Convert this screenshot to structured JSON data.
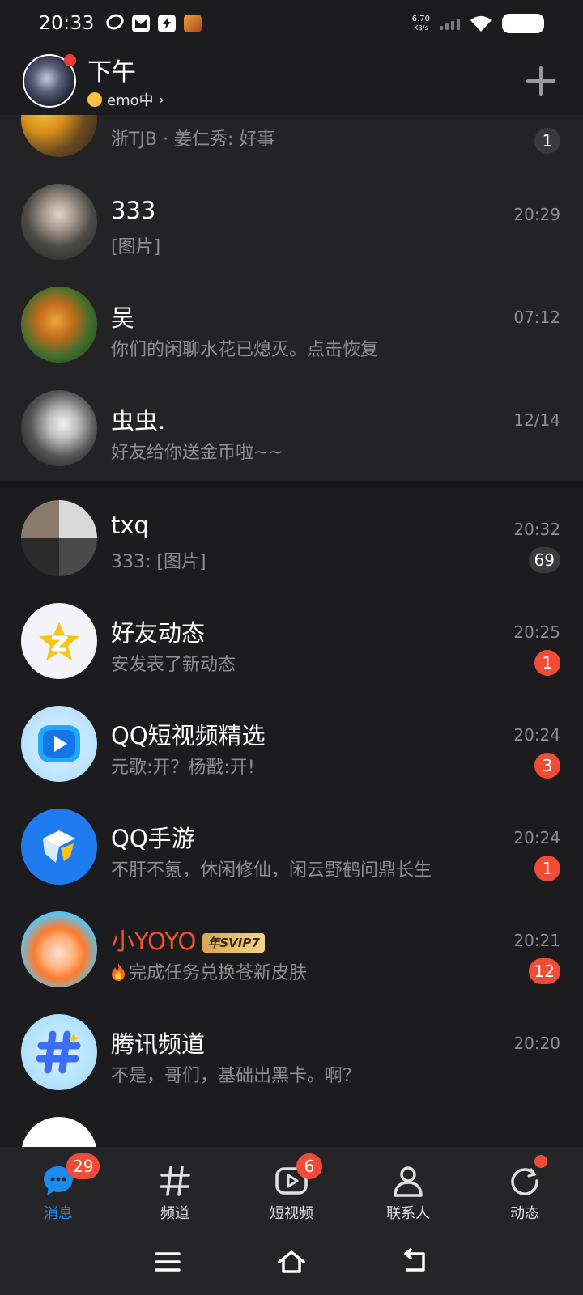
{
  "status_bar": {
    "time": "20:33",
    "net_speed_value": "6.70",
    "net_speed_unit": "KB/s"
  },
  "header": {
    "title": "下午",
    "status": "emo中"
  },
  "chats": [
    {
      "title": "",
      "subtitle": "浙TJB · 姜仁秀: 好事",
      "time": "",
      "badge": "1",
      "badge_style": "grey"
    },
    {
      "title": "333",
      "subtitle": "[图片]",
      "time": "20:29",
      "badge": "",
      "badge_style": ""
    },
    {
      "title": "吴",
      "subtitle": "你们的闲聊水花已熄灭。点击恢复",
      "time": "07:12",
      "badge": "",
      "badge_style": ""
    },
    {
      "title": "虫虫.",
      "subtitle": "好友给你送金币啦~~",
      "time": "12/14",
      "badge": "",
      "badge_style": ""
    },
    {
      "title": "txq",
      "subtitle": "333: [图片]",
      "time": "20:32",
      "badge": "69",
      "badge_style": "grey"
    },
    {
      "title": "好友动态",
      "subtitle": "安发表了新动态",
      "time": "20:25",
      "badge": "1",
      "badge_style": "red"
    },
    {
      "title": "QQ短视频精选",
      "subtitle": "元歌:开？杨戬:开!",
      "time": "20:24",
      "badge": "3",
      "badge_style": "red"
    },
    {
      "title": "QQ手游",
      "subtitle": "不肝不氪，休闲修仙，闲云野鹤问鼎长生",
      "time": "20:24",
      "badge": "1",
      "badge_style": "red"
    },
    {
      "title": "小YOYO",
      "title_tag": "年SVIP7",
      "subtitle": "完成任务兑换苍新皮肤",
      "time": "20:21",
      "badge": "12",
      "badge_style": "red"
    },
    {
      "title": "腾讯频道",
      "subtitle": "不是，哥们，基础出黑卡。啊？",
      "time": "20:20",
      "badge": "",
      "badge_style": ""
    }
  ],
  "bottom_nav": [
    {
      "label": "消息",
      "badge": "29",
      "active": true
    },
    {
      "label": "频道",
      "badge": "",
      "active": false
    },
    {
      "label": "短视频",
      "badge": "6",
      "active": false
    },
    {
      "label": "联系人",
      "badge": "",
      "active": false
    },
    {
      "label": "动态",
      "badge": "",
      "dot": true,
      "active": false
    }
  ],
  "colors": {
    "background": "#1c1c1e",
    "accent": "#1e8bf0",
    "badge_red": "#f04c38",
    "vip_name": "#f0532e"
  }
}
